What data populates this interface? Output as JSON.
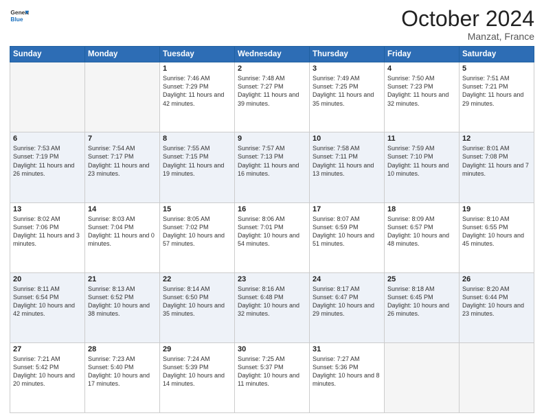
{
  "header": {
    "logo_general": "General",
    "logo_blue": "Blue",
    "month": "October 2024",
    "location": "Manzat, France"
  },
  "days_of_week": [
    "Sunday",
    "Monday",
    "Tuesday",
    "Wednesday",
    "Thursday",
    "Friday",
    "Saturday"
  ],
  "weeks": [
    [
      {
        "day": "",
        "sunrise": "",
        "sunset": "",
        "daylight": ""
      },
      {
        "day": "",
        "sunrise": "",
        "sunset": "",
        "daylight": ""
      },
      {
        "day": "1",
        "sunrise": "Sunrise: 7:46 AM",
        "sunset": "Sunset: 7:29 PM",
        "daylight": "Daylight: 11 hours and 42 minutes."
      },
      {
        "day": "2",
        "sunrise": "Sunrise: 7:48 AM",
        "sunset": "Sunset: 7:27 PM",
        "daylight": "Daylight: 11 hours and 39 minutes."
      },
      {
        "day": "3",
        "sunrise": "Sunrise: 7:49 AM",
        "sunset": "Sunset: 7:25 PM",
        "daylight": "Daylight: 11 hours and 35 minutes."
      },
      {
        "day": "4",
        "sunrise": "Sunrise: 7:50 AM",
        "sunset": "Sunset: 7:23 PM",
        "daylight": "Daylight: 11 hours and 32 minutes."
      },
      {
        "day": "5",
        "sunrise": "Sunrise: 7:51 AM",
        "sunset": "Sunset: 7:21 PM",
        "daylight": "Daylight: 11 hours and 29 minutes."
      }
    ],
    [
      {
        "day": "6",
        "sunrise": "Sunrise: 7:53 AM",
        "sunset": "Sunset: 7:19 PM",
        "daylight": "Daylight: 11 hours and 26 minutes."
      },
      {
        "day": "7",
        "sunrise": "Sunrise: 7:54 AM",
        "sunset": "Sunset: 7:17 PM",
        "daylight": "Daylight: 11 hours and 23 minutes."
      },
      {
        "day": "8",
        "sunrise": "Sunrise: 7:55 AM",
        "sunset": "Sunset: 7:15 PM",
        "daylight": "Daylight: 11 hours and 19 minutes."
      },
      {
        "day": "9",
        "sunrise": "Sunrise: 7:57 AM",
        "sunset": "Sunset: 7:13 PM",
        "daylight": "Daylight: 11 hours and 16 minutes."
      },
      {
        "day": "10",
        "sunrise": "Sunrise: 7:58 AM",
        "sunset": "Sunset: 7:11 PM",
        "daylight": "Daylight: 11 hours and 13 minutes."
      },
      {
        "day": "11",
        "sunrise": "Sunrise: 7:59 AM",
        "sunset": "Sunset: 7:10 PM",
        "daylight": "Daylight: 11 hours and 10 minutes."
      },
      {
        "day": "12",
        "sunrise": "Sunrise: 8:01 AM",
        "sunset": "Sunset: 7:08 PM",
        "daylight": "Daylight: 11 hours and 7 minutes."
      }
    ],
    [
      {
        "day": "13",
        "sunrise": "Sunrise: 8:02 AM",
        "sunset": "Sunset: 7:06 PM",
        "daylight": "Daylight: 11 hours and 3 minutes."
      },
      {
        "day": "14",
        "sunrise": "Sunrise: 8:03 AM",
        "sunset": "Sunset: 7:04 PM",
        "daylight": "Daylight: 11 hours and 0 minutes."
      },
      {
        "day": "15",
        "sunrise": "Sunrise: 8:05 AM",
        "sunset": "Sunset: 7:02 PM",
        "daylight": "Daylight: 10 hours and 57 minutes."
      },
      {
        "day": "16",
        "sunrise": "Sunrise: 8:06 AM",
        "sunset": "Sunset: 7:01 PM",
        "daylight": "Daylight: 10 hours and 54 minutes."
      },
      {
        "day": "17",
        "sunrise": "Sunrise: 8:07 AM",
        "sunset": "Sunset: 6:59 PM",
        "daylight": "Daylight: 10 hours and 51 minutes."
      },
      {
        "day": "18",
        "sunrise": "Sunrise: 8:09 AM",
        "sunset": "Sunset: 6:57 PM",
        "daylight": "Daylight: 10 hours and 48 minutes."
      },
      {
        "day": "19",
        "sunrise": "Sunrise: 8:10 AM",
        "sunset": "Sunset: 6:55 PM",
        "daylight": "Daylight: 10 hours and 45 minutes."
      }
    ],
    [
      {
        "day": "20",
        "sunrise": "Sunrise: 8:11 AM",
        "sunset": "Sunset: 6:54 PM",
        "daylight": "Daylight: 10 hours and 42 minutes."
      },
      {
        "day": "21",
        "sunrise": "Sunrise: 8:13 AM",
        "sunset": "Sunset: 6:52 PM",
        "daylight": "Daylight: 10 hours and 38 minutes."
      },
      {
        "day": "22",
        "sunrise": "Sunrise: 8:14 AM",
        "sunset": "Sunset: 6:50 PM",
        "daylight": "Daylight: 10 hours and 35 minutes."
      },
      {
        "day": "23",
        "sunrise": "Sunrise: 8:16 AM",
        "sunset": "Sunset: 6:48 PM",
        "daylight": "Daylight: 10 hours and 32 minutes."
      },
      {
        "day": "24",
        "sunrise": "Sunrise: 8:17 AM",
        "sunset": "Sunset: 6:47 PM",
        "daylight": "Daylight: 10 hours and 29 minutes."
      },
      {
        "day": "25",
        "sunrise": "Sunrise: 8:18 AM",
        "sunset": "Sunset: 6:45 PM",
        "daylight": "Daylight: 10 hours and 26 minutes."
      },
      {
        "day": "26",
        "sunrise": "Sunrise: 8:20 AM",
        "sunset": "Sunset: 6:44 PM",
        "daylight": "Daylight: 10 hours and 23 minutes."
      }
    ],
    [
      {
        "day": "27",
        "sunrise": "Sunrise: 7:21 AM",
        "sunset": "Sunset: 5:42 PM",
        "daylight": "Daylight: 10 hours and 20 minutes."
      },
      {
        "day": "28",
        "sunrise": "Sunrise: 7:23 AM",
        "sunset": "Sunset: 5:40 PM",
        "daylight": "Daylight: 10 hours and 17 minutes."
      },
      {
        "day": "29",
        "sunrise": "Sunrise: 7:24 AM",
        "sunset": "Sunset: 5:39 PM",
        "daylight": "Daylight: 10 hours and 14 minutes."
      },
      {
        "day": "30",
        "sunrise": "Sunrise: 7:25 AM",
        "sunset": "Sunset: 5:37 PM",
        "daylight": "Daylight: 10 hours and 11 minutes."
      },
      {
        "day": "31",
        "sunrise": "Sunrise: 7:27 AM",
        "sunset": "Sunset: 5:36 PM",
        "daylight": "Daylight: 10 hours and 8 minutes."
      },
      {
        "day": "",
        "sunrise": "",
        "sunset": "",
        "daylight": ""
      },
      {
        "day": "",
        "sunrise": "",
        "sunset": "",
        "daylight": ""
      }
    ]
  ]
}
